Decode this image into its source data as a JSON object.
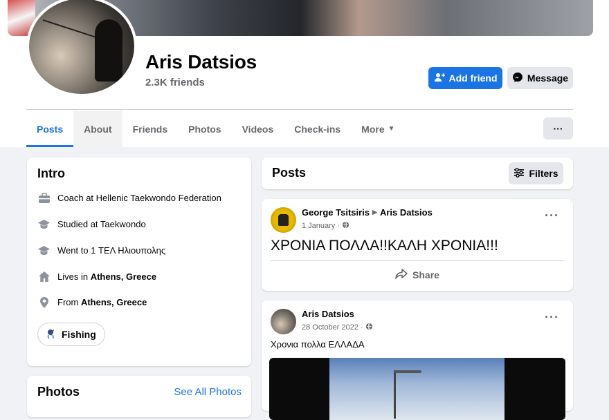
{
  "profile": {
    "name": "Aris Datsios",
    "friends": "2.3K friends",
    "add_friend_label": "Add friend",
    "message_label": "Message",
    "more_label": "···"
  },
  "tabs": [
    {
      "label": "Posts",
      "active": true
    },
    {
      "label": "About"
    },
    {
      "label": "Friends"
    },
    {
      "label": "Photos"
    },
    {
      "label": "Videos"
    },
    {
      "label": "Check-ins"
    },
    {
      "label": "More"
    }
  ],
  "intro": {
    "title": "Intro",
    "items": [
      {
        "icon": "briefcase-icon",
        "text": "Coach at Hellenic Taekwondo Federation"
      },
      {
        "icon": "graduation-cap-icon",
        "text": "Studied at Taekwondo"
      },
      {
        "icon": "graduation-cap-icon",
        "text": "Went to 1 ΤΕΛ Ηλιουπολης"
      },
      {
        "icon": "home-icon",
        "prefix": "Lives in ",
        "bold": "Athens, Greece"
      },
      {
        "icon": "location-pin-icon",
        "prefix": "From ",
        "bold": "Athens, Greece"
      }
    ],
    "hobby": "Fishing"
  },
  "photos_card": {
    "title": "Photos",
    "see_all": "See All Photos"
  },
  "posts_header": {
    "title": "Posts",
    "filters_label": "Filters"
  },
  "posts": [
    {
      "author": "George Tsitsiris",
      "target": "Aris Datsios",
      "date": "1 January",
      "text": "ΧΡΟΝΙΑ ΠΟΛΛΑ!!ΚΑΛΗ ΧΡΟΝΙΑ!!!",
      "share_label": "Share"
    },
    {
      "author": "Aris Datsios",
      "date": "28 October 2022",
      "text": "Χρονια πολλα ΕΛΛΑΔΑ"
    }
  ],
  "colors": {
    "accent": "#1b74e4",
    "background": "#f0f2f5",
    "secondary_text": "#65676b"
  }
}
